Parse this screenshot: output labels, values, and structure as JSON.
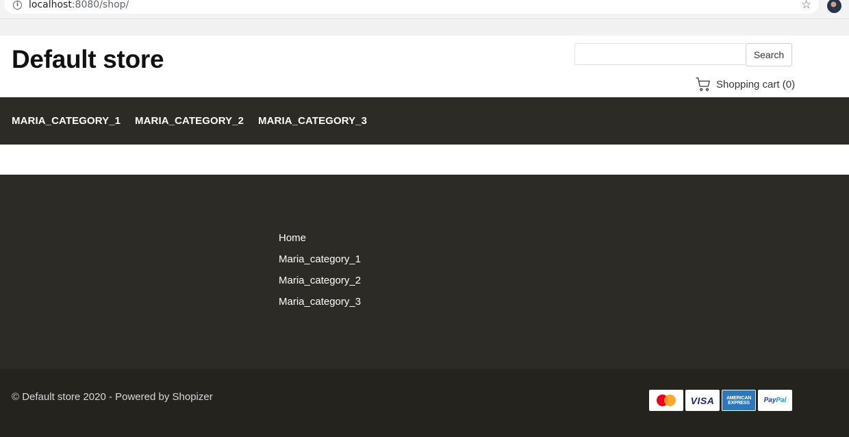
{
  "browser": {
    "url_host": "localhost",
    "url_rest": ":8080/shop/"
  },
  "header": {
    "store_title": "Default store",
    "search_placeholder": "",
    "search_label": "Search",
    "cart_label": "Shopping cart (0)"
  },
  "nav": {
    "items": [
      {
        "label": "MARIA_CATEGORY_1"
      },
      {
        "label": "MARIA_CATEGORY_2"
      },
      {
        "label": "MARIA_CATEGORY_3"
      }
    ]
  },
  "footer": {
    "links": [
      {
        "label": "Home"
      },
      {
        "label": "Maria_category_1"
      },
      {
        "label": "Maria_category_2"
      },
      {
        "label": "Maria_category_3"
      }
    ],
    "copyright": "© Default store 2020 - Powered by Shopizer",
    "payment_methods": [
      {
        "label": "MasterCard",
        "icon": "mastercard-icon"
      },
      {
        "label": "VISA",
        "icon": "visa-icon"
      },
      {
        "label": "AMERICAN EXPRESS",
        "icon": "amex-icon"
      },
      {
        "label": "PayPal",
        "icon": "paypal-icon"
      }
    ]
  },
  "colors": {
    "nav_background": "#2d2b25",
    "footer_background": "#2d2b25",
    "footer_bottom_background": "#24231e",
    "header_background": "#ffffff"
  }
}
